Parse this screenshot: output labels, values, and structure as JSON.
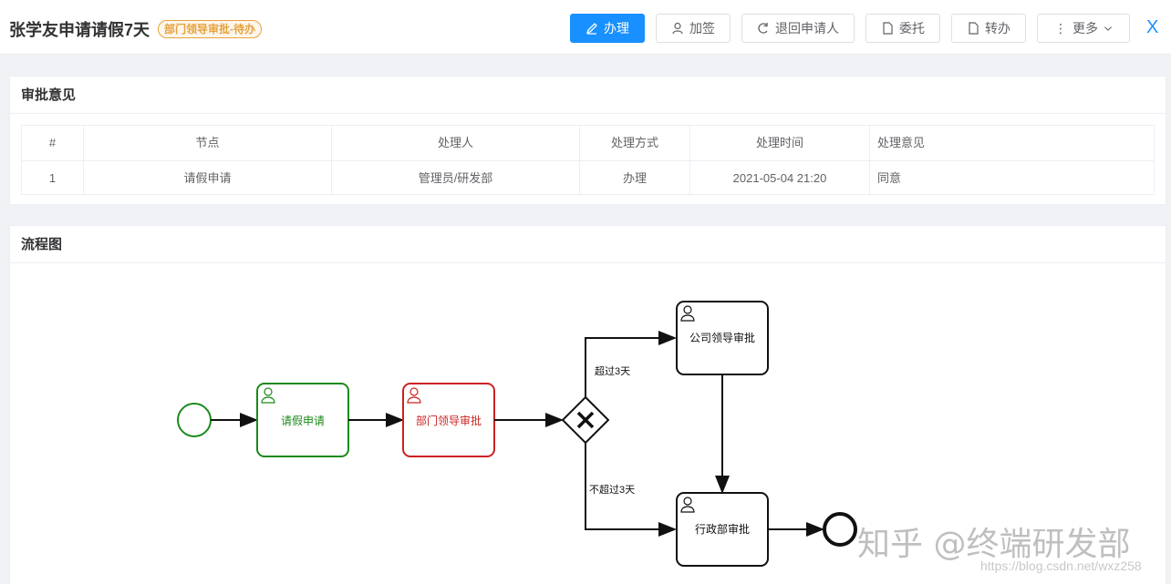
{
  "header": {
    "title": "张学友申请请假7天",
    "status": "部门领导审批-待办",
    "buttons": {
      "handle": "办理",
      "add_sign": "加签",
      "return": "退回申请人",
      "delegate": "委托",
      "transfer": "转办",
      "more": "更多"
    },
    "close": "X"
  },
  "approval": {
    "title": "审批意见",
    "columns": [
      "#",
      "节点",
      "处理人",
      "处理方式",
      "处理时间",
      "处理意见"
    ],
    "rows": [
      [
        "1",
        "请假申请",
        "管理员/研发部",
        "办理",
        "2021-05-04 21:20",
        "同意"
      ]
    ]
  },
  "flow": {
    "title": "流程图",
    "nodes": {
      "apply": "请假申请",
      "dept_leader": "部门领导审批",
      "company_leader": "公司领导审批",
      "admin_dept": "行政部审批"
    },
    "edges": {
      "over": "超过3天",
      "not_over": "不超过3天"
    },
    "colors": {
      "completed": "#1a8a1a",
      "current": "#cc2222",
      "pending": "#111111"
    }
  },
  "watermark": {
    "text": "知乎 @终端研发部",
    "url": "https://blog.csdn.net/wxz258"
  }
}
